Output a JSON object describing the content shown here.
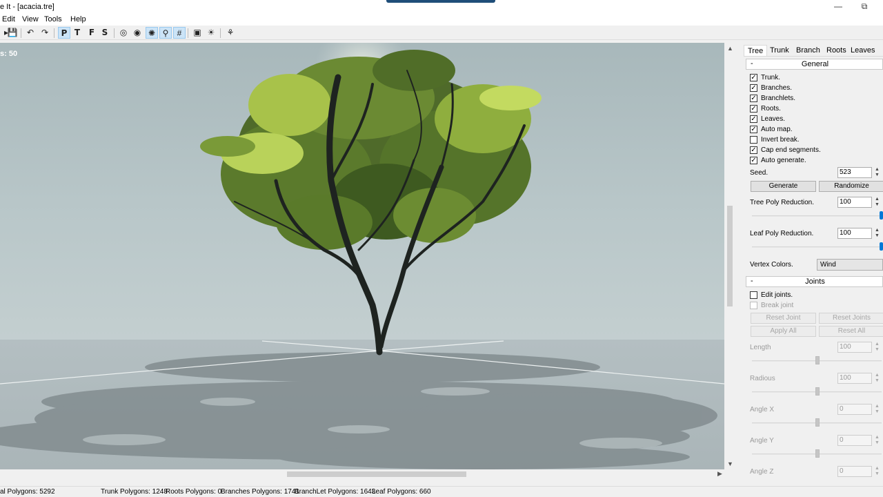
{
  "window": {
    "title": "e It - [acacia.tre]",
    "minimize_icon": "minimize-icon",
    "restore_icon": "restore-icon"
  },
  "menu": [
    "Edit",
    "View",
    "Tools",
    "Help"
  ],
  "toolbar": {
    "letters": [
      "P",
      "T",
      "F",
      "S"
    ]
  },
  "viewport": {
    "counter": "s: 50"
  },
  "panel": {
    "tabs": [
      "Tree",
      "Trunk",
      "Branch",
      "Roots",
      "Leaves"
    ],
    "general": {
      "header": "General",
      "collapse": "-",
      "checkboxes": [
        {
          "label": "Trunk.",
          "checked": true
        },
        {
          "label": "Branches.",
          "checked": true
        },
        {
          "label": "Branchlets.",
          "checked": true
        },
        {
          "label": "Roots.",
          "checked": true
        },
        {
          "label": "Leaves.",
          "checked": true
        },
        {
          "label": "Auto map.",
          "checked": true
        },
        {
          "label": "Invert break.",
          "checked": false
        },
        {
          "label": "Cap end segments.",
          "checked": true
        },
        {
          "label": "Auto generate.",
          "checked": true
        }
      ],
      "seed_label": "Seed.",
      "seed_value": "523",
      "generate": "Generate",
      "randomize": "Randomize",
      "tree_poly_label": "Tree Poly Reduction.",
      "tree_poly_value": "100",
      "tree_poly_level": 1.0,
      "leaf_poly_label": "Leaf Poly Reduction.",
      "leaf_poly_value": "100",
      "leaf_poly_level": 1.0,
      "vertex_colors_label": "Vertex Colors.",
      "vertex_colors_value": "Wind"
    },
    "joints": {
      "header": "Joints",
      "collapse": "-",
      "edit_joints": "Edit joints.",
      "break_joint": "Break joint",
      "reset_joint": "Reset Joint",
      "reset_joints": "Reset Joints",
      "apply_all": "Apply All",
      "reset_all": "Reset All",
      "length_label": "Length",
      "length_value": "100",
      "radius_label": "Radious",
      "radius_value": "100",
      "angle_x_label": "Angle X",
      "angle_x_value": "0",
      "angle_y_label": "Angle Y",
      "angle_y_value": "0",
      "angle_z_label": "Angle Z",
      "angle_z_value": "0"
    }
  },
  "status": {
    "total": "al Polygons: 5292",
    "trunk": "Trunk Polygons: 1248",
    "roots": "Roots Polygons: 0",
    "branches": "Branches Polygons: 1741",
    "branchlets": "BranchLet Polygons: 1643",
    "leaf": "Leaf Polygons:  660"
  }
}
